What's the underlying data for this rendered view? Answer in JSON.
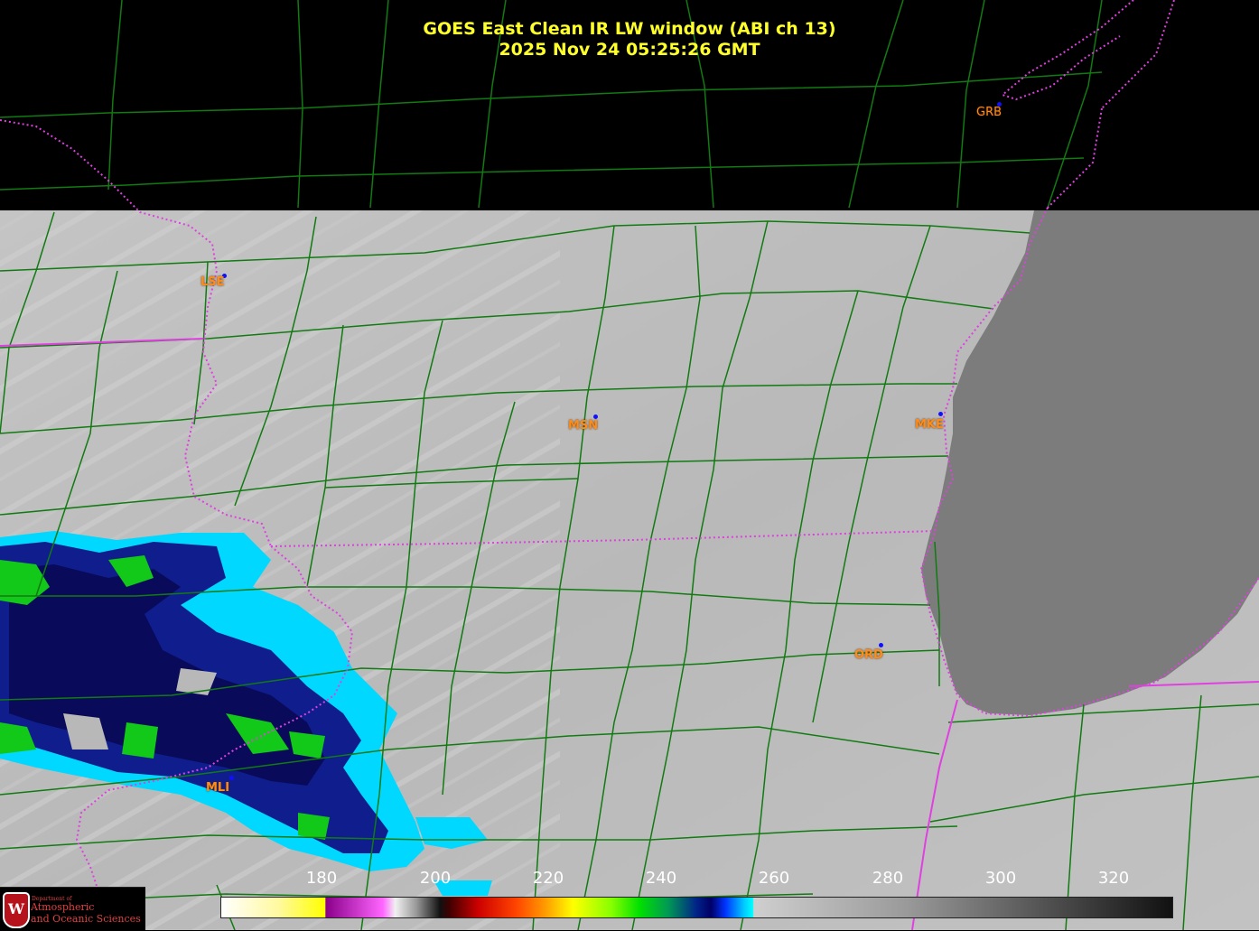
{
  "title": {
    "line1": "GOES East Clean IR LW window (ABI ch 13)",
    "line2": "2025 Nov 24  05:25:26 GMT"
  },
  "stations": [
    {
      "code": "GRB"
    },
    {
      "code": "LSE"
    },
    {
      "code": "MSN"
    },
    {
      "code": "MKE"
    },
    {
      "code": "ORD"
    },
    {
      "code": "MLI"
    }
  ],
  "colorbar": {
    "ticks": [
      "180",
      "200",
      "220",
      "240",
      "260",
      "280",
      "300",
      "320"
    ]
  },
  "logo": {
    "small_text": "Department of",
    "line1": "Atmospheric",
    "line2": "and Oceanic Sciences",
    "shield_letter": "W"
  },
  "colors": {
    "title": "#ffff2a",
    "county_lines": "#0f7a0f",
    "state_lines": "#e040e0",
    "station_label": "#ff8c1a",
    "station_dot": "#1010ff",
    "lake": "#7a7a7a",
    "land": "#b8b8b8"
  }
}
